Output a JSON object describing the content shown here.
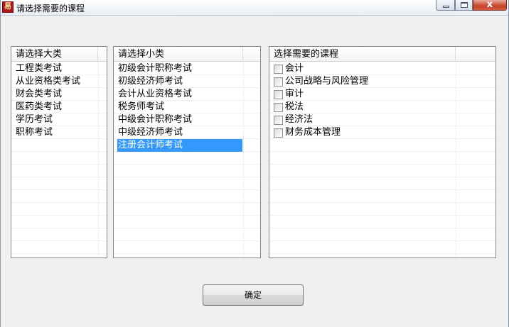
{
  "window": {
    "title": "请选择需要的课程",
    "icon": "app-logo-icon",
    "controls": {
      "minimize": "minimize-icon",
      "maximize": "maximize-icon",
      "close_glyph": "x"
    }
  },
  "category_list": {
    "header": "请选择大类",
    "items": [
      "工程类考试",
      "从业资格类考试",
      "财会类考试",
      "医药类考试",
      "学历考试",
      "职称考试"
    ]
  },
  "subcategory_list": {
    "header": "请选择小类",
    "items": [
      "初级会计职称考试",
      "初级经济师考试",
      "会计从业资格考试",
      "税务师考试",
      "中级会计职称考试",
      "中级经济师考试",
      "注册会计师考试"
    ],
    "selected_index": 6
  },
  "course_list": {
    "header": "选择需要的课程",
    "items": [
      {
        "label": "会计",
        "checked": false
      },
      {
        "label": "公司战略与风险管理",
        "checked": false
      },
      {
        "label": "审计",
        "checked": false
      },
      {
        "label": "税法",
        "checked": false
      },
      {
        "label": "经济法",
        "checked": false
      },
      {
        "label": "财务成本管理",
        "checked": false
      }
    ]
  },
  "confirm_button": {
    "label": "确定"
  },
  "colors": {
    "selection": "#3399ff",
    "window_bg": "#f0f0f0",
    "close_button": "#c7432b"
  }
}
